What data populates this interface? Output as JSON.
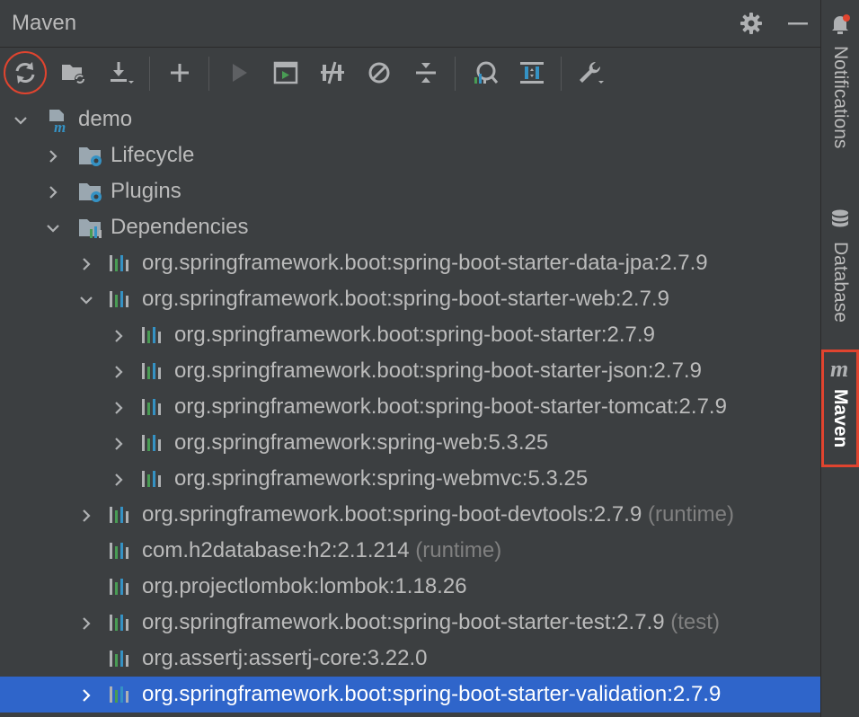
{
  "panel": {
    "title": "Maven"
  },
  "header": {
    "gear_icon": "gear-icon",
    "minimize_icon": "minimize-icon"
  },
  "toolbar": {
    "buttons": [
      {
        "name": "reload-all-maven-projects",
        "icon": "refresh-icon",
        "highlighted": true
      },
      {
        "name": "generate-sources-and-update-folders",
        "icon": "folder-refresh-icon"
      },
      {
        "name": "download-sources",
        "icon": "download-icon"
      },
      {
        "name": "add-maven-projects",
        "icon": "plus-icon"
      },
      {
        "name": "run-maven-build",
        "icon": "run-icon",
        "disabled": true
      },
      {
        "name": "execute-maven-goal",
        "icon": "terminal-icon"
      },
      {
        "name": "toggle-offline-mode",
        "icon": "offline-icon"
      },
      {
        "name": "skip-tests",
        "icon": "skip-tests-icon"
      },
      {
        "name": "collapse-all",
        "icon": "collapse-icon"
      },
      {
        "name": "analyze-dependencies",
        "icon": "analyze-icon"
      },
      {
        "name": "show-dependencies",
        "icon": "show-dependencies-icon"
      },
      {
        "name": "build-tool-settings",
        "icon": "wrench-icon"
      }
    ]
  },
  "tree": {
    "root": "demo",
    "lifecycle": "Lifecycle",
    "plugins": "Plugins",
    "dependencies": "Dependencies",
    "deps": [
      {
        "label": "org.springframework.boot:spring-boot-starter-data-jpa:2.7.9",
        "suffix": "",
        "expanded": false,
        "level": 1,
        "has_children": true
      },
      {
        "label": "org.springframework.boot:spring-boot-starter-web:2.7.9",
        "suffix": "",
        "expanded": true,
        "level": 1,
        "has_children": true
      },
      {
        "label": "org.springframework.boot:spring-boot-starter:2.7.9",
        "suffix": "",
        "expanded": false,
        "level": 2,
        "has_children": true
      },
      {
        "label": "org.springframework.boot:spring-boot-starter-json:2.7.9",
        "suffix": "",
        "expanded": false,
        "level": 2,
        "has_children": true
      },
      {
        "label": "org.springframework.boot:spring-boot-starter-tomcat:2.7.9",
        "suffix": "",
        "expanded": false,
        "level": 2,
        "has_children": true
      },
      {
        "label": "org.springframework:spring-web:5.3.25",
        "suffix": "",
        "expanded": false,
        "level": 2,
        "has_children": true
      },
      {
        "label": "org.springframework:spring-webmvc:5.3.25",
        "suffix": "",
        "expanded": false,
        "level": 2,
        "has_children": true
      },
      {
        "label": "org.springframework.boot:spring-boot-devtools:2.7.9",
        "suffix": "(runtime)",
        "expanded": false,
        "level": 1,
        "has_children": true
      },
      {
        "label": "com.h2database:h2:2.1.214",
        "suffix": "(runtime)",
        "expanded": false,
        "level": 1,
        "has_children": false
      },
      {
        "label": "org.projectlombok:lombok:1.18.26",
        "suffix": "",
        "expanded": false,
        "level": 1,
        "has_children": false
      },
      {
        "label": "org.springframework.boot:spring-boot-starter-test:2.7.9",
        "suffix": "(test)",
        "expanded": false,
        "level": 1,
        "has_children": true
      },
      {
        "label": "org.assertj:assertj-core:3.22.0",
        "suffix": "",
        "expanded": false,
        "level": 1,
        "has_children": false
      },
      {
        "label": "org.springframework.boot:spring-boot-starter-validation:2.7.9",
        "suffix": "",
        "expanded": false,
        "level": 1,
        "has_children": true,
        "selected": true
      }
    ]
  },
  "sidebar": {
    "tabs": [
      {
        "label": "Notifications",
        "icon": "bell-icon"
      },
      {
        "label": "Database",
        "icon": "database-icon"
      },
      {
        "label": "Maven",
        "icon": "maven-icon",
        "active": true
      }
    ]
  },
  "colors": {
    "background": "#3c3f41",
    "selection": "#2f65ca",
    "highlight_ring": "#e0442f",
    "text": "#bbbbbb",
    "secondary_text": "#808080"
  }
}
